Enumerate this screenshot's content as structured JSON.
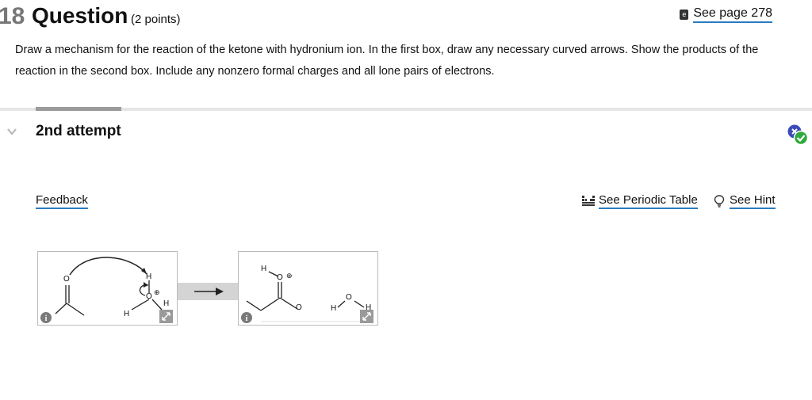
{
  "question": {
    "number": "18",
    "title": "Question",
    "points": "(2 points)",
    "see_page_icon": "ebook-icon",
    "see_page": "See page 278",
    "prompt": "Draw a mechanism for the reaction of the ketone with hydronium ion. In the first box, draw any necessary curved arrows. Show the products of the reaction in the second box. Include any nonzero formal charges and all lone pairs of electrons."
  },
  "attempt": {
    "label": "2nd attempt",
    "status_icons": [
      "incorrect-x-icon",
      "correct-check-icon"
    ]
  },
  "links": {
    "feedback": "Feedback",
    "periodic_table": "See Periodic Table",
    "hint": "See Hint"
  },
  "colors": {
    "link_underline": "#2a7bbf",
    "incorrect": "#3b4bb8",
    "correct": "#2faa3c",
    "arrow_band": "#d4d4d4"
  },
  "box1": {
    "atoms": {
      "o_ketone": "O",
      "h_hydronium_top": "H",
      "o_hydronium": "O",
      "o_charge": "⊕",
      "h_hydronium_left": "H",
      "h_hydronium_right": "H"
    }
  },
  "box2": {
    "atoms": {
      "h_protonated": "H",
      "o_protonated": "O",
      "o_charge": "⊕",
      "o_water": "O",
      "h_water_left": "H",
      "h_water_right": "H",
      "o_lower": "O"
    }
  }
}
